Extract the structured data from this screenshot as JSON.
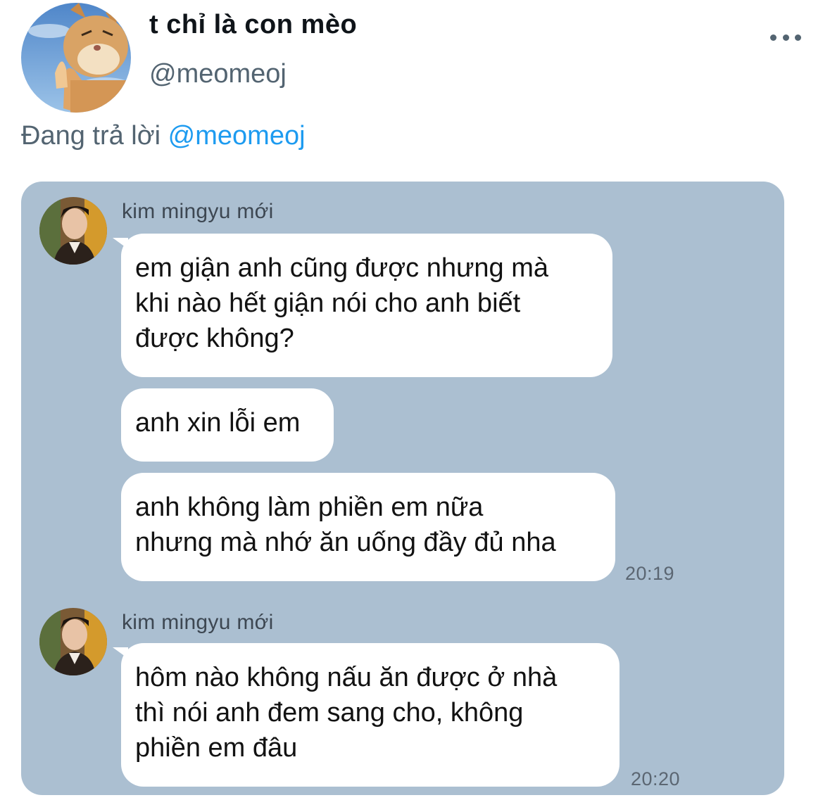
{
  "tweet": {
    "display_name": "t chỉ là con mèo",
    "handle": "@meomeoj",
    "reply_prefix": "Đang trả lời",
    "reply_to": "@meomeoj",
    "more_icon": "more-horizontal-icon",
    "colors": {
      "link": "#1d9bf0",
      "secondary_text": "#536471",
      "chat_background": "#abbfd1"
    }
  },
  "chat": {
    "groups": [
      {
        "sender": "kim mingyu mới",
        "messages": [
          "em giận anh cũng được nhưng mà\nkhi nào hết giận nói cho anh biết\nđược không?",
          "anh xin lỗi em",
          "anh không làm phiền em nữa\nnhưng mà nhớ ăn uống đầy đủ nha"
        ],
        "time": "20:19"
      },
      {
        "sender": "kim mingyu mới",
        "messages": [
          "hôm nào không nấu ăn được ở nhà\nthì nói anh đem sang cho, không\nphiền em đâu"
        ],
        "time": "20:20"
      }
    ]
  }
}
